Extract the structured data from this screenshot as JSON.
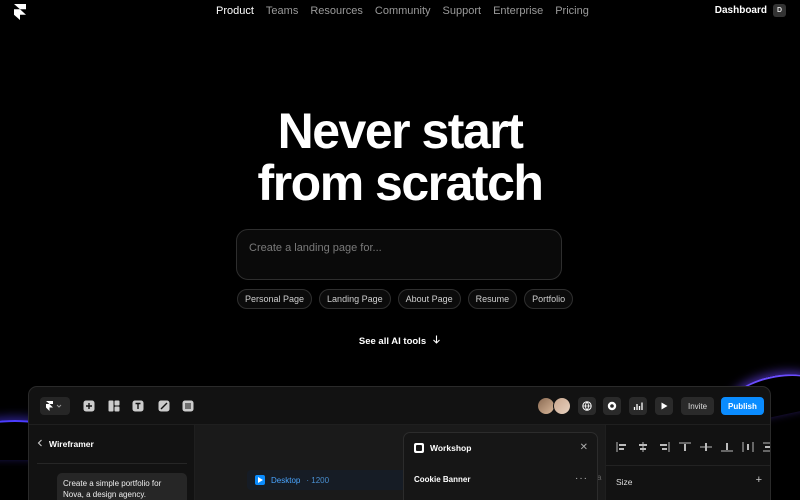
{
  "nav": {
    "links": [
      {
        "label": "Product",
        "active": true
      },
      {
        "label": "Teams",
        "active": false
      },
      {
        "label": "Resources",
        "active": false
      },
      {
        "label": "Community",
        "active": false
      },
      {
        "label": "Support",
        "active": false
      },
      {
        "label": "Enterprise",
        "active": false
      },
      {
        "label": "Pricing",
        "active": false
      }
    ],
    "dashboard_label": "Dashboard",
    "dashboard_badge": "D"
  },
  "hero": {
    "title_line1": "Never start",
    "title_line2": "from scratch",
    "prompt_placeholder": "Create a landing page for...",
    "chips": [
      "Personal Page",
      "Landing Page",
      "About Page",
      "Resume",
      "Portfolio"
    ],
    "see_all": "See all AI tools"
  },
  "editor": {
    "invite_label": "Invite",
    "publish_label": "Publish",
    "accent": "#0a8cff",
    "left_panel": {
      "title": "Wireframer",
      "message": "Create a simple portfolio for Nova, a design agency."
    },
    "canvas": {
      "frame_name": "Desktop",
      "frame_size": "1200",
      "peek_text": "Ta"
    },
    "popup": {
      "title": "Workshop",
      "row_label": "Cookie Banner"
    },
    "right_panel": {
      "size_label": "Size"
    }
  }
}
